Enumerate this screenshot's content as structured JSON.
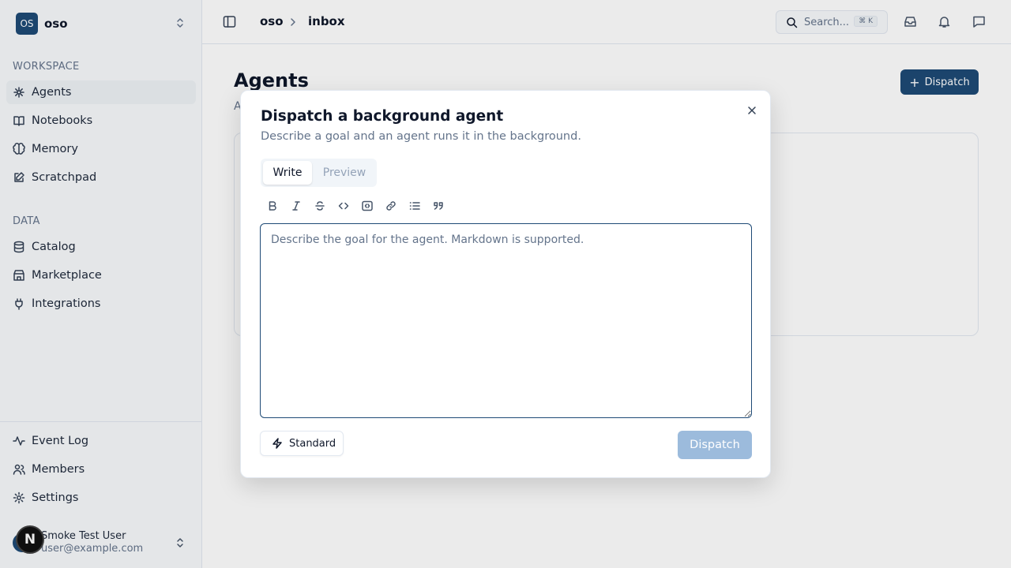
{
  "sidebar": {
    "workspace": {
      "logo": "OS",
      "name": "oso"
    },
    "workspace_label": "WORKSPACE",
    "workspace_items": [
      {
        "label": "Agents",
        "icon": "agents-icon"
      },
      {
        "label": "Notebooks",
        "icon": "book-icon"
      },
      {
        "label": "Memory",
        "icon": "brain-icon"
      },
      {
        "label": "Scratchpad",
        "icon": "edit-icon"
      }
    ],
    "data_label": "DATA",
    "data_items": [
      {
        "label": "Catalog",
        "icon": "database-icon"
      },
      {
        "label": "Marketplace",
        "icon": "store-icon"
      },
      {
        "label": "Integrations",
        "icon": "plug-icon"
      }
    ],
    "footer_items": [
      {
        "label": "Event Log",
        "icon": "activity-icon"
      },
      {
        "label": "Members",
        "icon": "users-icon"
      },
      {
        "label": "Settings",
        "icon": "gear-icon"
      }
    ],
    "user": {
      "name": "Smoke Test User",
      "email": "user@example.com",
      "badge": "N"
    }
  },
  "topbar": {
    "breadcrumb": [
      "oso",
      "inbox"
    ],
    "search_placeholder": "Search...",
    "search_shortcut": "⌘ K"
  },
  "main": {
    "title": "Agents",
    "subtitle": "A",
    "dispatch_label": "Dispatch"
  },
  "modal": {
    "title": "Dispatch a background agent",
    "description": "Describe a goal and an agent runs it in the background.",
    "tabs": [
      "Write",
      "Preview"
    ],
    "active_tab": "Write",
    "toolbar": [
      "bold-icon",
      "italic-icon",
      "strikethrough-icon",
      "code-icon",
      "code-block-icon",
      "link-icon",
      "list-icon",
      "quote-icon"
    ],
    "editor_value": "",
    "editor_placeholder": "Describe the goal for the agent. Markdown is supported.",
    "mode_label": "Standard",
    "submit_label": "Dispatch"
  },
  "colors": {
    "brand": "#1e4a76",
    "submit_disabled": "#9cbbdc"
  }
}
